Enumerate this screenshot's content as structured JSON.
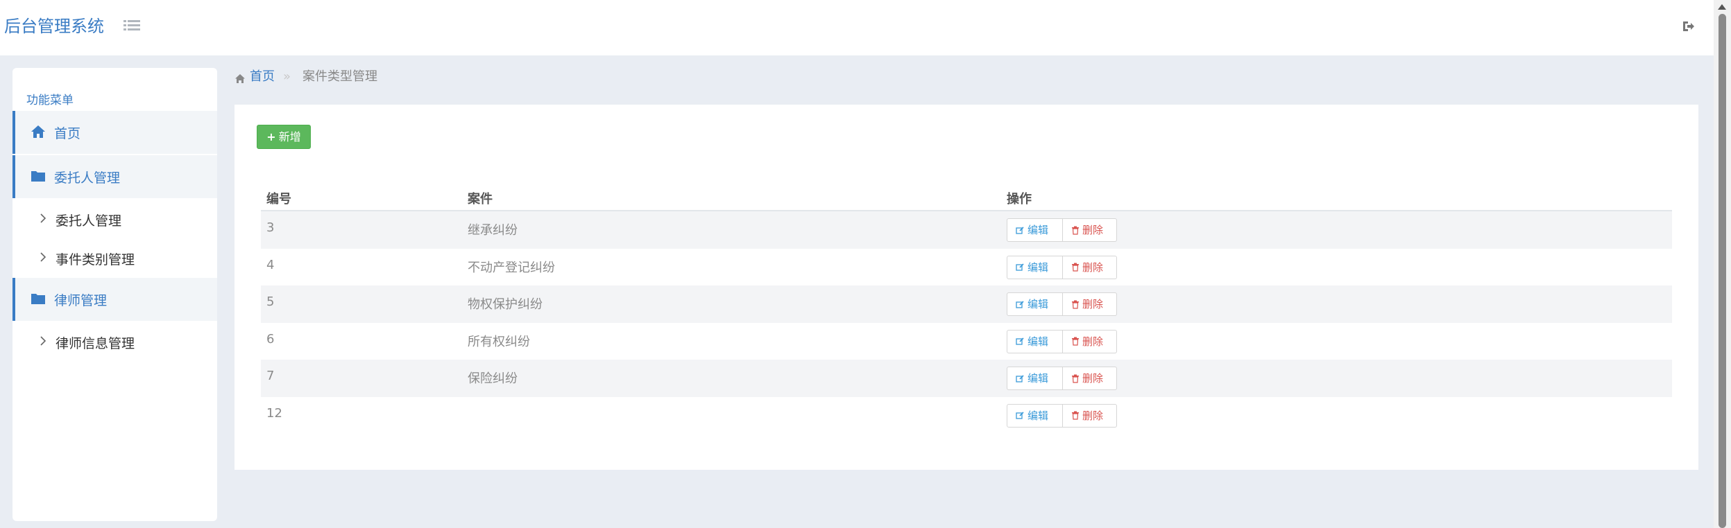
{
  "header": {
    "brand": "后台管理系统"
  },
  "sidebar": {
    "title": "功能菜单",
    "items": [
      {
        "label": "首页",
        "icon": "home-icon"
      },
      {
        "label": "委托人管理",
        "icon": "folder-icon"
      },
      {
        "label": "委托人管理",
        "icon": "chevron-right-icon"
      },
      {
        "label": "事件类别管理",
        "icon": "chevron-right-icon"
      },
      {
        "label": "律师管理",
        "icon": "folder-icon"
      },
      {
        "label": "律师信息管理",
        "icon": "chevron-right-icon"
      }
    ]
  },
  "breadcrumb": {
    "home": "首页",
    "separator": "»",
    "current": "案件类型管理"
  },
  "toolbar": {
    "add_label": "新增"
  },
  "table": {
    "columns": [
      "编号",
      "案件",
      "操作"
    ],
    "rows": [
      {
        "id": "3",
        "name": "继承纠纷"
      },
      {
        "id": "4",
        "name": "不动产登记纠纷"
      },
      {
        "id": "5",
        "name": "物权保护纠纷"
      },
      {
        "id": "6",
        "name": "所有权纠纷"
      },
      {
        "id": "7",
        "name": "保险纠纷"
      },
      {
        "id": "12",
        "name": ""
      }
    ],
    "edit_label": "编辑",
    "delete_label": "删除"
  },
  "colors": {
    "accent": "#3a7cc4",
    "success": "#5cb85c",
    "danger": "#d9534f",
    "info": "#3a9ad9",
    "background": "#e9edf3"
  }
}
